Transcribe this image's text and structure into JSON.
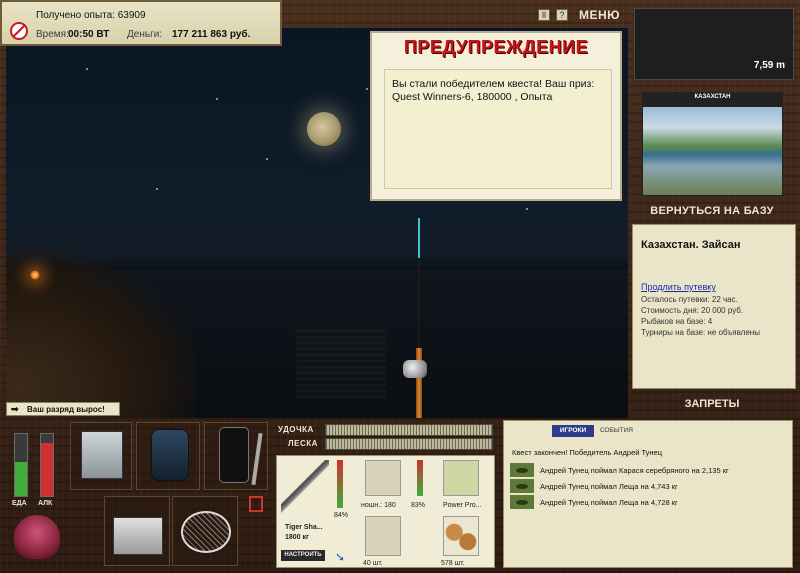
{
  "hud": {
    "xp_text": "Получено опыта: 63909",
    "time_label": "Время:",
    "time_value": "00:50 ВТ",
    "money_label": "Деньги:",
    "money_value": "177 211 863 руб."
  },
  "top_controls": {
    "pause_icon": "pause-icon",
    "help_icon": "help-icon",
    "menu_label": "МЕНЮ"
  },
  "depth": {
    "value": "7,59 m"
  },
  "warning": {
    "title": "ПРЕДУПРЕЖДЕНИЕ",
    "message": "Вы стали победителем квеста! Ваш приз: Quest Winners-6, 180000 , Опыта"
  },
  "location": {
    "banner": "КАЗАХСТАН",
    "return_label": "ВЕРНУТЬСЯ НА БАЗУ",
    "name": "Казахстан. Зайсан",
    "extend_link": "Продлить путевку",
    "lines": [
      "Осталось путевки: 22 час.",
      "Стоимость дня: 20 000 руб.",
      "Рыбаков на базе: 4",
      "Турниры на базе: не объявлены"
    ],
    "bans_label": "ЗАПРЕТЫ"
  },
  "rank": {
    "text": "Ваш разряд вырос!"
  },
  "gauges": {
    "food_label": "ЕДА",
    "alc_label": "АЛК",
    "food_level": 0.55,
    "alc_level": 0.85,
    "food_color": "#3fae3a",
    "alc_color": "#d03030"
  },
  "rod_controls": {
    "rod_label": "УДОЧКА",
    "line_label": "ЛЕСКА"
  },
  "tackle": {
    "rod_name": "Tiger Sha...",
    "rod_weight": "1800 кг",
    "rod_pct": "84%",
    "reel_name": "ношн.: 180",
    "reel_pct": "83%",
    "line_name": "Power Pro...",
    "hook_count": "40 шт.",
    "bait_count": "578 шт.",
    "tune_label": "НАСТРОИТЬ"
  },
  "events": {
    "tab_players": "ИГРОКИ",
    "tab_events": "СОБЫТИЯ",
    "message": "Квест закончен! Победитель Андрей Тунец",
    "rows": [
      "Андрей Тунец поймал Карася серебряного на 2,135 кг",
      "Андрей Тунец поймал Леща на 4,743 кг",
      "Андрей Тунец поймал Леща на 4,728 кг"
    ]
  }
}
